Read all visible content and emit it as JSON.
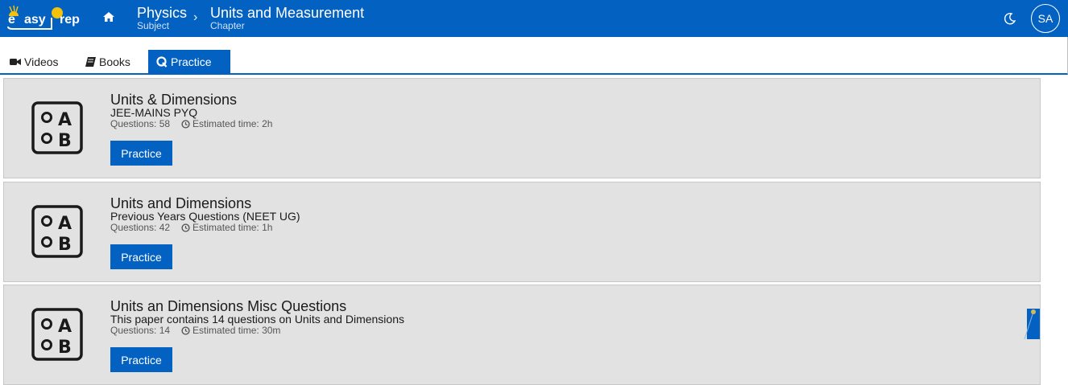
{
  "header": {
    "logo_text_1": "asy",
    "logo_text_2": "rep",
    "subject": "Physics",
    "subject_label": "Subject",
    "chapter": "Units and Measurement",
    "chapter_label": "Chapter",
    "avatar_initials": "SA",
    "home_icon": "home-icon",
    "theme_icon": "moon-icon"
  },
  "tabs": [
    {
      "label": "Videos",
      "icon": "video-camera-icon",
      "active": false
    },
    {
      "label": "Books",
      "icon": "book-icon",
      "active": false
    },
    {
      "label": "Practice",
      "icon": "q-icon",
      "active": true
    }
  ],
  "cards": [
    {
      "title": "Units & Dimensions",
      "subtitle": "JEE-MAINS PYQ",
      "questions": "Questions: 58",
      "time": "Estimated time: 2h",
      "button": "Practice"
    },
    {
      "title": "Units and Dimensions",
      "subtitle": "Previous Years Questions (NEET UG)",
      "questions": "Questions: 42",
      "time": "Estimated time: 1h",
      "button": "Practice"
    },
    {
      "title": "Units an Dimensions Misc Questions",
      "subtitle": "This paper contains 14 questions on Units and Dimensions",
      "questions": "Questions: 14",
      "time": "Estimated time: 30m",
      "button": "Practice"
    }
  ],
  "colors": {
    "primary": "#0361c2",
    "card_bg": "#e2e2e2"
  }
}
